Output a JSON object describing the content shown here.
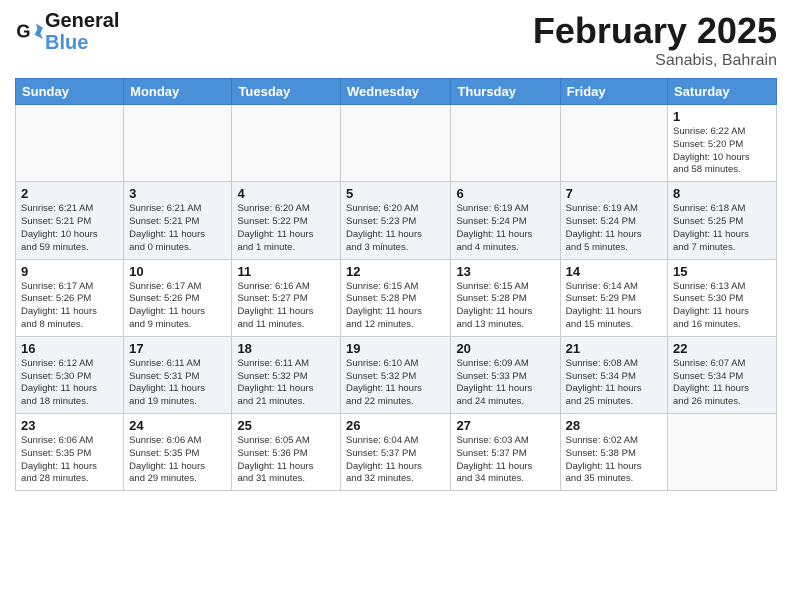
{
  "header": {
    "logo_line1": "General",
    "logo_line2": "Blue",
    "month_title": "February 2025",
    "location": "Sanabis, Bahrain"
  },
  "days_of_week": [
    "Sunday",
    "Monday",
    "Tuesday",
    "Wednesday",
    "Thursday",
    "Friday",
    "Saturday"
  ],
  "weeks": [
    [
      {
        "day": "",
        "info": ""
      },
      {
        "day": "",
        "info": ""
      },
      {
        "day": "",
        "info": ""
      },
      {
        "day": "",
        "info": ""
      },
      {
        "day": "",
        "info": ""
      },
      {
        "day": "",
        "info": ""
      },
      {
        "day": "1",
        "info": "Sunrise: 6:22 AM\nSunset: 5:20 PM\nDaylight: 10 hours\nand 58 minutes."
      }
    ],
    [
      {
        "day": "2",
        "info": "Sunrise: 6:21 AM\nSunset: 5:21 PM\nDaylight: 10 hours\nand 59 minutes."
      },
      {
        "day": "3",
        "info": "Sunrise: 6:21 AM\nSunset: 5:21 PM\nDaylight: 11 hours\nand 0 minutes."
      },
      {
        "day": "4",
        "info": "Sunrise: 6:20 AM\nSunset: 5:22 PM\nDaylight: 11 hours\nand 1 minute."
      },
      {
        "day": "5",
        "info": "Sunrise: 6:20 AM\nSunset: 5:23 PM\nDaylight: 11 hours\nand 3 minutes."
      },
      {
        "day": "6",
        "info": "Sunrise: 6:19 AM\nSunset: 5:24 PM\nDaylight: 11 hours\nand 4 minutes."
      },
      {
        "day": "7",
        "info": "Sunrise: 6:19 AM\nSunset: 5:24 PM\nDaylight: 11 hours\nand 5 minutes."
      },
      {
        "day": "8",
        "info": "Sunrise: 6:18 AM\nSunset: 5:25 PM\nDaylight: 11 hours\nand 7 minutes."
      }
    ],
    [
      {
        "day": "9",
        "info": "Sunrise: 6:17 AM\nSunset: 5:26 PM\nDaylight: 11 hours\nand 8 minutes."
      },
      {
        "day": "10",
        "info": "Sunrise: 6:17 AM\nSunset: 5:26 PM\nDaylight: 11 hours\nand 9 minutes."
      },
      {
        "day": "11",
        "info": "Sunrise: 6:16 AM\nSunset: 5:27 PM\nDaylight: 11 hours\nand 11 minutes."
      },
      {
        "day": "12",
        "info": "Sunrise: 6:15 AM\nSunset: 5:28 PM\nDaylight: 11 hours\nand 12 minutes."
      },
      {
        "day": "13",
        "info": "Sunrise: 6:15 AM\nSunset: 5:28 PM\nDaylight: 11 hours\nand 13 minutes."
      },
      {
        "day": "14",
        "info": "Sunrise: 6:14 AM\nSunset: 5:29 PM\nDaylight: 11 hours\nand 15 minutes."
      },
      {
        "day": "15",
        "info": "Sunrise: 6:13 AM\nSunset: 5:30 PM\nDaylight: 11 hours\nand 16 minutes."
      }
    ],
    [
      {
        "day": "16",
        "info": "Sunrise: 6:12 AM\nSunset: 5:30 PM\nDaylight: 11 hours\nand 18 minutes."
      },
      {
        "day": "17",
        "info": "Sunrise: 6:11 AM\nSunset: 5:31 PM\nDaylight: 11 hours\nand 19 minutes."
      },
      {
        "day": "18",
        "info": "Sunrise: 6:11 AM\nSunset: 5:32 PM\nDaylight: 11 hours\nand 21 minutes."
      },
      {
        "day": "19",
        "info": "Sunrise: 6:10 AM\nSunset: 5:32 PM\nDaylight: 11 hours\nand 22 minutes."
      },
      {
        "day": "20",
        "info": "Sunrise: 6:09 AM\nSunset: 5:33 PM\nDaylight: 11 hours\nand 24 minutes."
      },
      {
        "day": "21",
        "info": "Sunrise: 6:08 AM\nSunset: 5:34 PM\nDaylight: 11 hours\nand 25 minutes."
      },
      {
        "day": "22",
        "info": "Sunrise: 6:07 AM\nSunset: 5:34 PM\nDaylight: 11 hours\nand 26 minutes."
      }
    ],
    [
      {
        "day": "23",
        "info": "Sunrise: 6:06 AM\nSunset: 5:35 PM\nDaylight: 11 hours\nand 28 minutes."
      },
      {
        "day": "24",
        "info": "Sunrise: 6:06 AM\nSunset: 5:35 PM\nDaylight: 11 hours\nand 29 minutes."
      },
      {
        "day": "25",
        "info": "Sunrise: 6:05 AM\nSunset: 5:36 PM\nDaylight: 11 hours\nand 31 minutes."
      },
      {
        "day": "26",
        "info": "Sunrise: 6:04 AM\nSunset: 5:37 PM\nDaylight: 11 hours\nand 32 minutes."
      },
      {
        "day": "27",
        "info": "Sunrise: 6:03 AM\nSunset: 5:37 PM\nDaylight: 11 hours\nand 34 minutes."
      },
      {
        "day": "28",
        "info": "Sunrise: 6:02 AM\nSunset: 5:38 PM\nDaylight: 11 hours\nand 35 minutes."
      },
      {
        "day": "",
        "info": ""
      }
    ]
  ]
}
